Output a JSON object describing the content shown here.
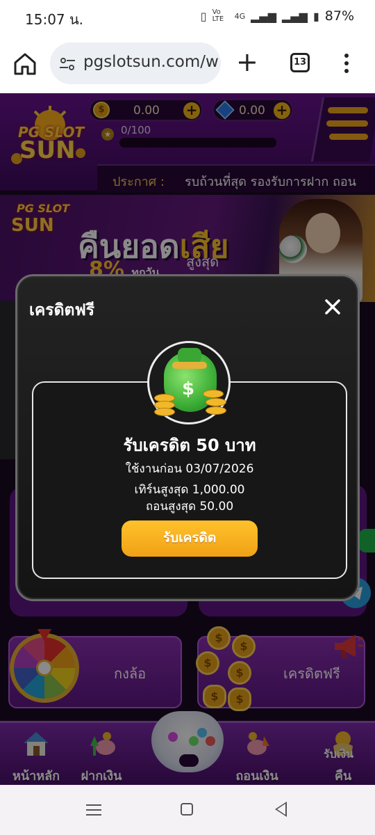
{
  "status_bar": {
    "time": "15:07 น.",
    "battery": "87%",
    "network": "4G",
    "volte": "Vo LTE"
  },
  "browser": {
    "url": "pgslotsun.com/w",
    "tab_count": "13"
  },
  "header": {
    "logo_line1": "PG SLOT",
    "logo_line2": "SUN",
    "coin_balance": "0.00",
    "gem_balance": "0.00",
    "xp_progress": "0/100",
    "xp_fraction": 0
  },
  "announcement": {
    "label": "ประกาศ :",
    "text": "รบถ้วนที่สุด รองรับการฝาก ถอน"
  },
  "banner": {
    "logo_line1": "PG SLOT",
    "logo_line2": "SUN",
    "title_white": "คืนยอด",
    "title_gold": "เสีย",
    "sub1": "8%",
    "sub2": "ทุกวัน",
    "sub3": "สูงสุด"
  },
  "menu_cards": {
    "wheel_label": "กงล้อ",
    "free_credit_label": "เครดิตฟรี"
  },
  "bottom_nav": {
    "items": [
      {
        "label": "หน้าหลัก",
        "icon": "house-icon"
      },
      {
        "label": "ฝากเงิน",
        "icon": "deposit-piggy-icon"
      },
      {
        "label": "ถอนเงิน",
        "icon": "withdraw-piggy-icon"
      },
      {
        "label": "คืน",
        "icon": "cashback-icon",
        "overlay": "รับเงิน"
      }
    ]
  },
  "modal": {
    "title": "เครดิตฟรี",
    "reward_title": "รับเครดิต 50 บาท",
    "expire_text": "ใช้งานก่อน 03/07/2026",
    "turnover_text": "เทิร์นสูงสุด 1,000.00",
    "max_withdraw_text": "ถอนสูงสุด 50.00",
    "claim_button": "รับเครดิต"
  },
  "colors": {
    "brand_purple": "#6a1390",
    "accent_gold": "#f6b71b",
    "modal_bg": "#141414"
  }
}
